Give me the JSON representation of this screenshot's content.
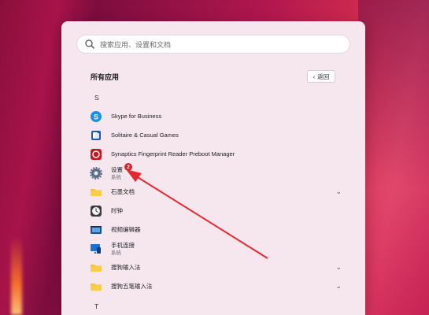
{
  "colors": {
    "accent": "#d8232a",
    "menu_bg": "#f6e6ee",
    "folder": "#f5c02f"
  },
  "search": {
    "placeholder": "搜索应用、设置和文档"
  },
  "all_apps": {
    "title": "所有应用",
    "back_label": "返回"
  },
  "letters": {
    "s": "S",
    "t": "T"
  },
  "apps": [
    {
      "name": "Skype for Business",
      "icon": "skype-icon"
    },
    {
      "name": "Solitaire & Casual Games",
      "icon": "solitaire-icon"
    },
    {
      "name": "Synaptics Fingerprint Reader Preboot Manager",
      "icon": "synaptics-icon"
    },
    {
      "name": "设置",
      "sub": "系统",
      "icon": "gear-icon",
      "badge": "2"
    },
    {
      "name": "石墨文档",
      "icon": "folder-icon",
      "expandable": true
    },
    {
      "name": "时钟",
      "icon": "clock-icon"
    },
    {
      "name": "视频编辑器",
      "icon": "video-editor-icon"
    },
    {
      "name": "手机连接",
      "sub": "系统",
      "icon": "phone-link-icon"
    },
    {
      "name": "搜狗输入法",
      "icon": "folder-icon",
      "expandable": true
    },
    {
      "name": "搜狗五笔输入法",
      "icon": "folder-icon",
      "expandable": true
    }
  ]
}
